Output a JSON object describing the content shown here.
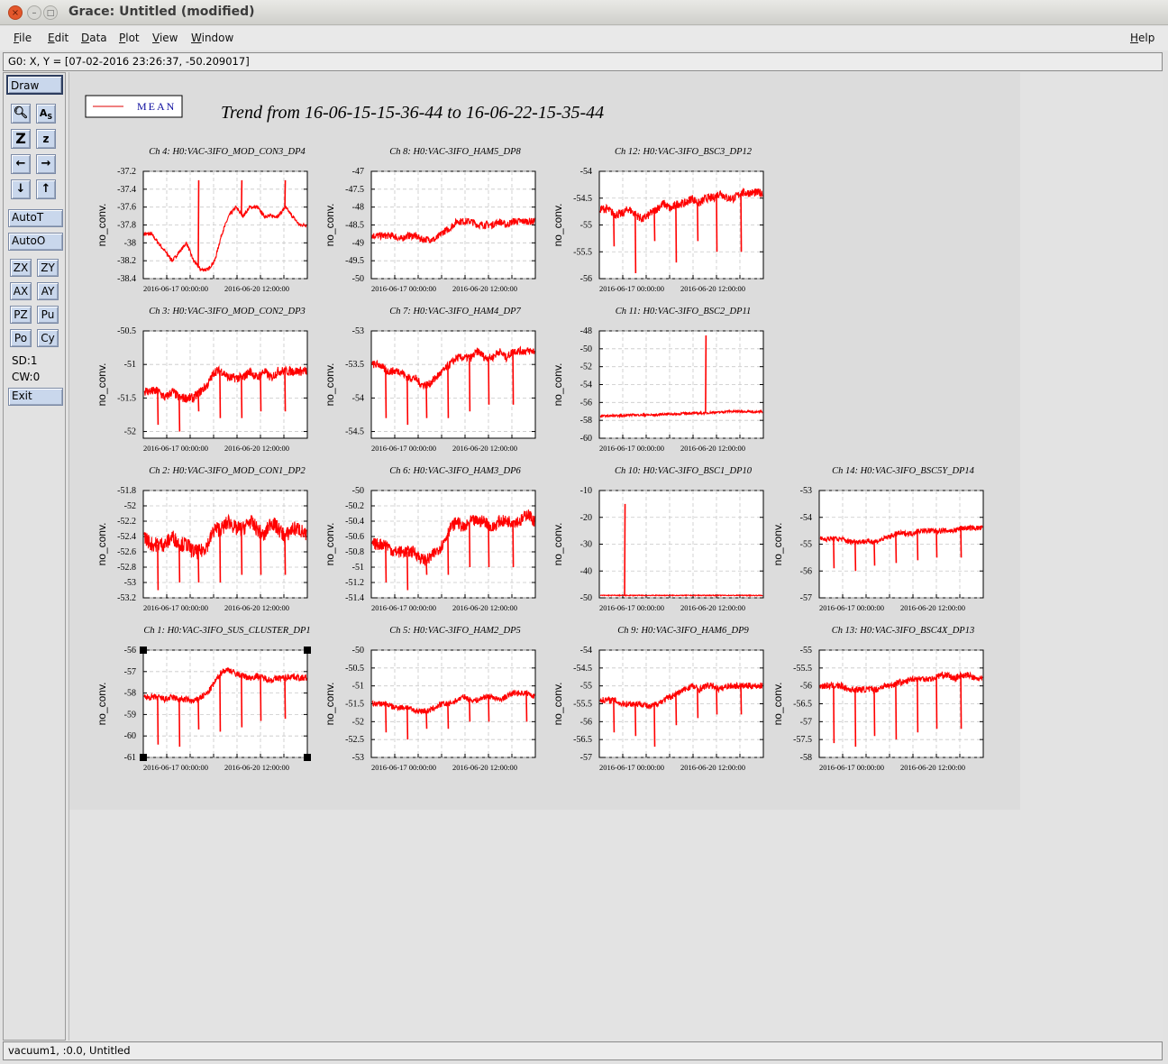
{
  "window": {
    "title": "Grace: Untitled (modified)"
  },
  "menu": {
    "file": "File",
    "edit": "Edit",
    "data": "Data",
    "plot": "Plot",
    "view": "View",
    "window": "Window",
    "help": "Help"
  },
  "locator": "G0: X, Y = [07-02-2016 23:26:37, -50.209017]",
  "status": "vacuum1, :0.0, Untitled",
  "toolbar": {
    "draw": "Draw",
    "autot": "AutoT",
    "autoo": "AutoO",
    "zx": "ZX",
    "zy": "ZY",
    "ax": "AX",
    "ay": "AY",
    "pz": "PZ",
    "pu": "Pu",
    "po": "Po",
    "cy": "Cy",
    "sd": "SD:1",
    "cw": "CW:0",
    "exit": "Exit"
  },
  "figure": {
    "title": "Trend from 16-06-15-15-36-44 to 16-06-22-15-35-44",
    "legend": "MEAN",
    "series_color": "#ff0000"
  },
  "chart_data": [
    {
      "type": "line",
      "title": "Ch 4: H0:VAC-3IFO_MOD_CON3_DP4",
      "ylabel": "no_conv.",
      "yticks": [
        "-37.2",
        "-37.4",
        "-37.6",
        "-37.8",
        "-38",
        "-38.2",
        "-38.4"
      ],
      "ylim": [
        -38.4,
        -37.2
      ],
      "xticks": [
        "2016-06-17 00:00:00",
        "2016-06-20 12:00:00"
      ],
      "series": [
        {
          "values": [
            -37.9,
            -37.9,
            -38.0,
            -38.1,
            -38.2,
            -38.1,
            -38.0,
            -38.2,
            -38.3,
            -38.3,
            -38.2,
            -37.9,
            -37.7,
            -37.6,
            -37.7,
            -37.6,
            -37.6,
            -37.7,
            -37.7,
            -37.7,
            -37.6,
            -37.7,
            -37.8,
            -37.8
          ]
        }
      ],
      "spikes": [
        {
          "i": 20,
          "v": -37.3
        },
        {
          "i": 36,
          "v": -37.3
        },
        {
          "i": 52,
          "v": -37.3
        }
      ],
      "noise": 0.02,
      "spike_dir": "up"
    },
    {
      "type": "line",
      "title": "Ch 8: H0:VAC-3IFO_HAM5_DP8",
      "ylabel": "no_conv.",
      "yticks": [
        "-47",
        "-47.5",
        "-48",
        "-48.5",
        "-49",
        "-49.5",
        "-50"
      ],
      "ylim": [
        -50,
        -47
      ],
      "xticks": [
        "2016-06-17 00:00:00",
        "2016-06-20 12:00:00"
      ],
      "series": [
        {
          "values": [
            -48.8,
            -48.8,
            -48.8,
            -48.8,
            -48.9,
            -48.8,
            -48.8,
            -48.9,
            -48.9,
            -48.9,
            -48.7,
            -48.6,
            -48.4,
            -48.4,
            -48.4,
            -48.5,
            -48.5,
            -48.5,
            -48.4,
            -48.5,
            -48.4,
            -48.4,
            -48.4,
            -48.4
          ]
        }
      ],
      "spikes": [],
      "noise": 0.1,
      "spike_dir": "down"
    },
    {
      "type": "line",
      "title": "Ch 12: H0:VAC-3IFO_BSC3_DP12",
      "ylabel": "no_conv.",
      "yticks": [
        "-54",
        "-54.5",
        "-55",
        "-55.5",
        "-56"
      ],
      "ylim": [
        -56,
        -54
      ],
      "xticks": [
        "2016-06-17 00:00:00",
        "2016-06-20 12:00:00"
      ],
      "series": [
        {
          "values": [
            -54.7,
            -54.7,
            -54.8,
            -54.8,
            -54.7,
            -54.8,
            -54.9,
            -54.8,
            -54.7,
            -54.6,
            -54.7,
            -54.6,
            -54.6,
            -54.5,
            -54.6,
            -54.5,
            -54.5,
            -54.4,
            -54.5,
            -54.5,
            -54.4,
            -54.4,
            -54.4,
            -54.4
          ]
        }
      ],
      "spikes": [
        {
          "i": 5,
          "v": -55.4
        },
        {
          "i": 13,
          "v": -55.9
        },
        {
          "i": 20,
          "v": -55.3
        },
        {
          "i": 28,
          "v": -55.7
        },
        {
          "i": 36,
          "v": -55.3
        },
        {
          "i": 43,
          "v": -55.5
        },
        {
          "i": 52,
          "v": -55.5
        }
      ],
      "noise": 0.08,
      "spike_dir": "down"
    },
    {
      "type": "line",
      "title": "Ch 3: H0:VAC-3IFO_MOD_CON2_DP3",
      "ylabel": "no_conv.",
      "yticks": [
        "-50.5",
        "-51",
        "-51.5",
        "-52"
      ],
      "ylim": [
        -52.1,
        -50.5
      ],
      "xticks": [
        "2016-06-17 00:00:00",
        "2016-06-20 12:00:00"
      ],
      "series": [
        {
          "values": [
            -51.4,
            -51.4,
            -51.4,
            -51.5,
            -51.4,
            -51.5,
            -51.5,
            -51.5,
            -51.4,
            -51.3,
            -51.1,
            -51.1,
            -51.2,
            -51.2,
            -51.2,
            -51.1,
            -51.2,
            -51.1,
            -51.2,
            -51.1,
            -51.1,
            -51.1,
            -51.1,
            -51.1
          ]
        }
      ],
      "spikes": [
        {
          "i": 5,
          "v": -51.9
        },
        {
          "i": 13,
          "v": -52.0
        },
        {
          "i": 20,
          "v": -51.7
        },
        {
          "i": 28,
          "v": -51.8
        },
        {
          "i": 36,
          "v": -51.8
        },
        {
          "i": 43,
          "v": -51.7
        },
        {
          "i": 52,
          "v": -51.7
        }
      ],
      "noise": 0.07,
      "spike_dir": "down"
    },
    {
      "type": "line",
      "title": "Ch 7: H0:VAC-3IFO_HAM4_DP7",
      "ylabel": "no_conv.",
      "yticks": [
        "-53",
        "-53.5",
        "-54",
        "-54.5"
      ],
      "ylim": [
        -54.6,
        -53
      ],
      "xticks": [
        "2016-06-17 00:00:00",
        "2016-06-20 12:00:00"
      ],
      "series": [
        {
          "values": [
            -53.5,
            -53.5,
            -53.6,
            -53.6,
            -53.6,
            -53.7,
            -53.7,
            -53.8,
            -53.8,
            -53.7,
            -53.6,
            -53.5,
            -53.4,
            -53.4,
            -53.4,
            -53.3,
            -53.4,
            -53.4,
            -53.3,
            -53.4,
            -53.3,
            -53.3,
            -53.3,
            -53.3
          ]
        }
      ],
      "spikes": [
        {
          "i": 5,
          "v": -54.3
        },
        {
          "i": 13,
          "v": -54.4
        },
        {
          "i": 20,
          "v": -54.3
        },
        {
          "i": 28,
          "v": -54.3
        },
        {
          "i": 36,
          "v": -54.2
        },
        {
          "i": 43,
          "v": -54.1
        },
        {
          "i": 52,
          "v": -54.1
        }
      ],
      "noise": 0.06,
      "spike_dir": "down"
    },
    {
      "type": "line",
      "title": "Ch 11: H0:VAC-3IFO_BSC2_DP11",
      "ylabel": "no_conv.",
      "yticks": [
        "-48",
        "-50",
        "-52",
        "-54",
        "-56",
        "-58",
        "-60"
      ],
      "ylim": [
        -60,
        -48
      ],
      "xticks": [
        "2016-06-17 00:00:00",
        "2016-06-20 12:00:00"
      ],
      "series": [
        {
          "values": [
            -57.5,
            -57.5,
            -57.5,
            -57.5,
            -57.4,
            -57.4,
            -57.4,
            -57.4,
            -57.4,
            -57.3,
            -57.3,
            -57.3,
            -57.2,
            -57.2,
            -57.2,
            -57.2,
            -57.1,
            -57.1,
            -57.0,
            -57.0,
            -57.0,
            -57.0,
            -57.1,
            -57.0
          ]
        }
      ],
      "spikes": [
        {
          "i": 39,
          "v": -48.5
        }
      ],
      "noise": 0.12,
      "spike_dir": "up"
    },
    {
      "type": "line",
      "title": "Ch 2: H0:VAC-3IFO_MOD_CON1_DP2",
      "ylabel": "no_conv.",
      "yticks": [
        "-51.8",
        "-52",
        "-52.2",
        "-52.4",
        "-52.6",
        "-52.8",
        "-53",
        "-53.2"
      ],
      "ylim": [
        -53.2,
        -51.8
      ],
      "xticks": [
        "2016-06-17 00:00:00",
        "2016-06-20 12:00:00"
      ],
      "series": [
        {
          "values": [
            -52.4,
            -52.5,
            -52.5,
            -52.5,
            -52.4,
            -52.5,
            -52.5,
            -52.6,
            -52.6,
            -52.5,
            -52.3,
            -52.3,
            -52.2,
            -52.3,
            -52.3,
            -52.2,
            -52.3,
            -52.4,
            -52.2,
            -52.3,
            -52.4,
            -52.3,
            -52.3,
            -52.4
          ]
        }
      ],
      "spikes": [
        {
          "i": 5,
          "v": -53.1
        },
        {
          "i": 13,
          "v": -53.0
        },
        {
          "i": 20,
          "v": -53.0
        },
        {
          "i": 28,
          "v": -53.0
        },
        {
          "i": 36,
          "v": -52.9
        },
        {
          "i": 43,
          "v": -52.9
        },
        {
          "i": 52,
          "v": -52.9
        }
      ],
      "noise": 0.1,
      "spike_dir": "down"
    },
    {
      "type": "line",
      "title": "Ch 6: H0:VAC-3IFO_HAM3_DP6",
      "ylabel": "no_conv.",
      "yticks": [
        "-50",
        "-50.2",
        "-50.4",
        "-50.6",
        "-50.8",
        "-51",
        "-51.2",
        "-51.4"
      ],
      "ylim": [
        -51.4,
        -50
      ],
      "xticks": [
        "2016-06-17 00:00:00",
        "2016-06-20 12:00:00"
      ],
      "series": [
        {
          "values": [
            -50.7,
            -50.7,
            -50.7,
            -50.8,
            -50.8,
            -50.8,
            -50.8,
            -50.9,
            -50.9,
            -50.8,
            -50.7,
            -50.5,
            -50.4,
            -50.5,
            -50.4,
            -50.4,
            -50.4,
            -50.5,
            -50.4,
            -50.4,
            -50.4,
            -50.4,
            -50.3,
            -50.4
          ]
        }
      ],
      "spikes": [
        {
          "i": 5,
          "v": -51.2
        },
        {
          "i": 13,
          "v": -51.3
        },
        {
          "i": 20,
          "v": -51.1
        },
        {
          "i": 28,
          "v": -51.1
        },
        {
          "i": 36,
          "v": -51.0
        },
        {
          "i": 43,
          "v": -51.0
        },
        {
          "i": 52,
          "v": -51.0
        }
      ],
      "noise": 0.08,
      "spike_dir": "down"
    },
    {
      "type": "line",
      "title": "Ch 10: H0:VAC-3IFO_BSC1_DP10",
      "ylabel": "no_conv.",
      "yticks": [
        "-10",
        "-20",
        "-30",
        "-40",
        "-50"
      ],
      "ylim": [
        -50,
        -10
      ],
      "xticks": [
        "2016-06-17 00:00:00",
        "2016-06-20 12:00:00"
      ],
      "series": [
        {
          "values": [
            -49.1,
            -49.1,
            -49.1,
            -49.1,
            -49.1,
            -49.1,
            -49.1,
            -49.1,
            -49.1,
            -49.1,
            -49.1,
            -49.1,
            -49.1,
            -49.1,
            -49.1,
            -49.1,
            -49.1,
            -49.1,
            -49.1,
            -49.1,
            -49.1,
            -49.1,
            -49.1,
            -49.1
          ]
        }
      ],
      "spikes": [
        {
          "i": 9,
          "v": -15.0
        }
      ],
      "noise": 0.15,
      "spike_dir": "up"
    },
    {
      "type": "line",
      "title": "Ch 14: H0:VAC-3IFO_BSC5Y_DP14",
      "ylabel": "no_conv.",
      "yticks": [
        "-53",
        "-54",
        "-55",
        "-56",
        "-57"
      ],
      "ylim": [
        -57,
        -53
      ],
      "xticks": [
        "2016-06-17 00:00:00",
        "2016-06-20 12:00:00"
      ],
      "series": [
        {
          "values": [
            -54.8,
            -54.8,
            -54.8,
            -54.8,
            -54.9,
            -54.9,
            -54.9,
            -54.9,
            -54.9,
            -54.8,
            -54.7,
            -54.6,
            -54.6,
            -54.6,
            -54.5,
            -54.5,
            -54.5,
            -54.5,
            -54.5,
            -54.5,
            -54.4,
            -54.4,
            -54.4,
            -54.4
          ]
        }
      ],
      "spikes": [
        {
          "i": 5,
          "v": -55.9
        },
        {
          "i": 13,
          "v": -56.0
        },
        {
          "i": 20,
          "v": -55.8
        },
        {
          "i": 28,
          "v": -55.7
        },
        {
          "i": 36,
          "v": -55.6
        },
        {
          "i": 43,
          "v": -55.5
        },
        {
          "i": 52,
          "v": -55.5
        }
      ],
      "noise": 0.1,
      "spike_dir": "down"
    },
    {
      "type": "line",
      "title": "Ch 1: H0:VAC-3IFO_SUS_CLUSTER_DP1",
      "ylabel": "no_conv.",
      "yticks": [
        "-56",
        "-57",
        "-58",
        "-59",
        "-60",
        "-61"
      ],
      "ylim": [
        -61,
        -56
      ],
      "xticks": [
        "2016-06-17 00:00:00",
        "2016-06-20 12:00:00"
      ],
      "series": [
        {
          "values": [
            -58.2,
            -58.2,
            -58.2,
            -58.3,
            -58.2,
            -58.3,
            -58.3,
            -58.4,
            -58.2,
            -58.0,
            -57.5,
            -57.0,
            -56.9,
            -57.1,
            -57.2,
            -57.3,
            -57.2,
            -57.3,
            -57.4,
            -57.3,
            -57.3,
            -57.2,
            -57.3,
            -57.3
          ]
        }
      ],
      "spikes": [
        {
          "i": 5,
          "v": -60.4
        },
        {
          "i": 13,
          "v": -60.5
        },
        {
          "i": 20,
          "v": -59.7
        },
        {
          "i": 28,
          "v": -59.8
        },
        {
          "i": 36,
          "v": -59.6
        },
        {
          "i": 43,
          "v": -59.3
        },
        {
          "i": 52,
          "v": -59.2
        }
      ],
      "noise": 0.15,
      "spike_dir": "down"
    },
    {
      "type": "line",
      "title": "Ch 5: H0:VAC-3IFO_HAM2_DP5",
      "ylabel": "no_conv.",
      "yticks": [
        "-50",
        "-50.5",
        "-51",
        "-51.5",
        "-52",
        "-52.5",
        "-53"
      ],
      "ylim": [
        -53,
        -50
      ],
      "xticks": [
        "2016-06-17 00:00:00",
        "2016-06-20 12:00:00"
      ],
      "series": [
        {
          "values": [
            -51.5,
            -51.5,
            -51.5,
            -51.6,
            -51.6,
            -51.6,
            -51.7,
            -51.7,
            -51.7,
            -51.6,
            -51.5,
            -51.5,
            -51.4,
            -51.3,
            -51.4,
            -51.4,
            -51.3,
            -51.3,
            -51.4,
            -51.3,
            -51.2,
            -51.2,
            -51.2,
            -51.3
          ]
        }
      ],
      "spikes": [
        {
          "i": 5,
          "v": -52.3
        },
        {
          "i": 13,
          "v": -52.5
        },
        {
          "i": 20,
          "v": -52.2
        },
        {
          "i": 28,
          "v": -52.2
        },
        {
          "i": 36,
          "v": -52.0
        },
        {
          "i": 43,
          "v": -52.0
        },
        {
          "i": 57,
          "v": -52.0
        }
      ],
      "noise": 0.08,
      "spike_dir": "down"
    },
    {
      "type": "line",
      "title": "Ch 9: H0:VAC-3IFO_HAM6_DP9",
      "ylabel": "no_conv.",
      "yticks": [
        "-54",
        "-54.5",
        "-55",
        "-55.5",
        "-56",
        "-56.5",
        "-57"
      ],
      "ylim": [
        -57,
        -54
      ],
      "xticks": [
        "2016-06-17 00:00:00",
        "2016-06-20 12:00:00"
      ],
      "series": [
        {
          "values": [
            -55.4,
            -55.4,
            -55.4,
            -55.5,
            -55.5,
            -55.5,
            -55.5,
            -55.6,
            -55.5,
            -55.4,
            -55.3,
            -55.2,
            -55.1,
            -55.0,
            -55.1,
            -55.0,
            -55.0,
            -55.1,
            -55.0,
            -55.0,
            -55.0,
            -55.0,
            -55.0,
            -55.0
          ]
        }
      ],
      "spikes": [
        {
          "i": 5,
          "v": -56.3
        },
        {
          "i": 13,
          "v": -56.4
        },
        {
          "i": 20,
          "v": -56.7
        },
        {
          "i": 28,
          "v": -56.1
        },
        {
          "i": 36,
          "v": -55.9
        },
        {
          "i": 43,
          "v": -55.8
        },
        {
          "i": 52,
          "v": -55.8
        }
      ],
      "noise": 0.09,
      "spike_dir": "down"
    },
    {
      "type": "line",
      "title": "Ch 13: H0:VAC-3IFO_BSC4X_DP13",
      "ylabel": "no_conv.",
      "yticks": [
        "-55",
        "-55.5",
        "-56",
        "-56.5",
        "-57",
        "-57.5",
        "-58"
      ],
      "ylim": [
        -58,
        -55
      ],
      "xticks": [
        "2016-06-17 00:00:00",
        "2016-06-20 12:00:00"
      ],
      "series": [
        {
          "values": [
            -56.0,
            -56.0,
            -56.0,
            -56.0,
            -56.1,
            -56.1,
            -56.1,
            -56.1,
            -56.1,
            -56.0,
            -56.0,
            -55.9,
            -55.9,
            -55.8,
            -55.8,
            -55.8,
            -55.8,
            -55.7,
            -55.7,
            -55.8,
            -55.7,
            -55.7,
            -55.8,
            -55.8
          ]
        }
      ],
      "spikes": [
        {
          "i": 5,
          "v": -57.6
        },
        {
          "i": 13,
          "v": -57.7
        },
        {
          "i": 20,
          "v": -57.4
        },
        {
          "i": 28,
          "v": -57.5
        },
        {
          "i": 36,
          "v": -57.3
        },
        {
          "i": 43,
          "v": -57.2
        },
        {
          "i": 52,
          "v": -57.2
        }
      ],
      "noise": 0.09,
      "spike_dir": "down"
    }
  ]
}
